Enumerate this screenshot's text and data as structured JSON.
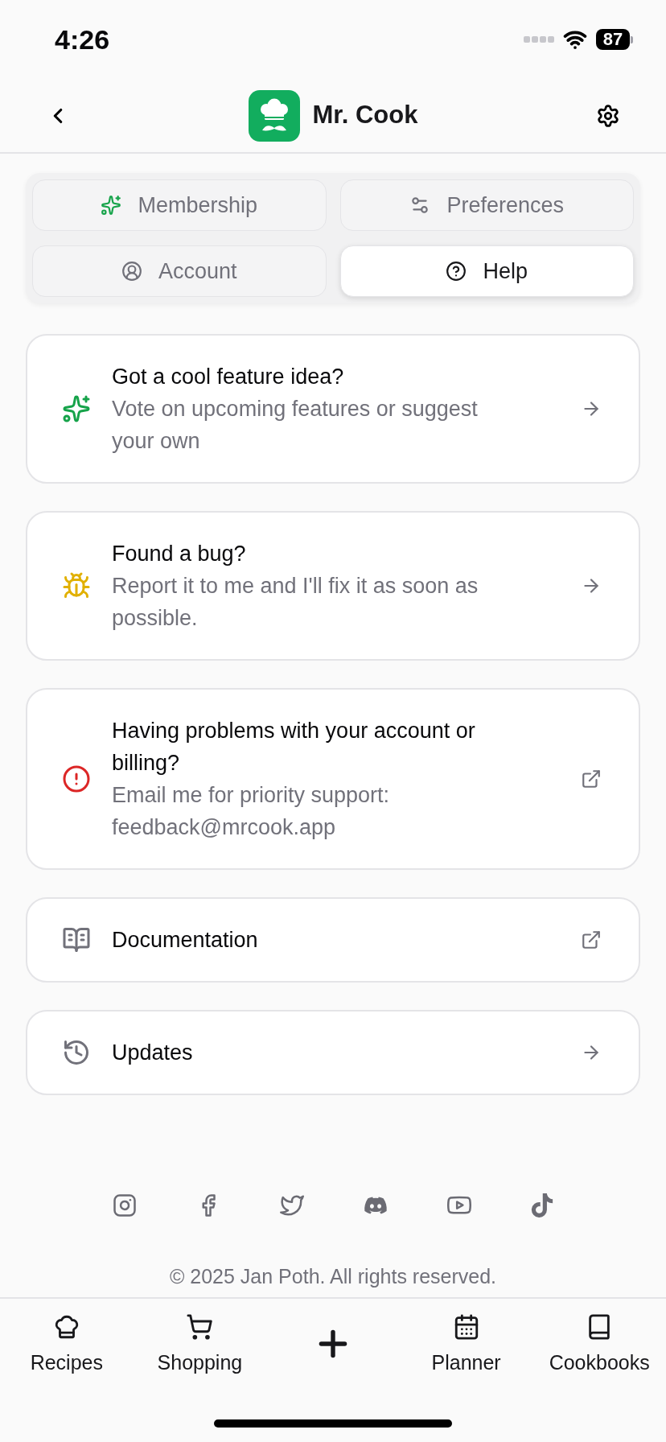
{
  "status_bar": {
    "time": "4:26",
    "battery": "87"
  },
  "header": {
    "title": "Mr. Cook"
  },
  "tabs": [
    {
      "label": "Membership",
      "selected": false
    },
    {
      "label": "Preferences",
      "selected": false
    },
    {
      "label": "Account",
      "selected": false
    },
    {
      "label": "Help",
      "selected": true
    }
  ],
  "cards": [
    {
      "title": "Got a cool feature idea?",
      "description": "Vote on upcoming features or suggest your own",
      "kind": "internal"
    },
    {
      "title": "Found a bug?",
      "description": "Report it to me and I'll fix it as soon as possible.",
      "kind": "internal"
    },
    {
      "title": "Having problems with your account or billing?",
      "description": "Email me for priority support: feedback@mrcook.app",
      "kind": "external"
    },
    {
      "title": "Documentation",
      "kind": "external"
    },
    {
      "title": "Updates",
      "kind": "internal"
    }
  ],
  "footer": {
    "copyright": "© 2025 Jan Poth. All rights reserved."
  },
  "nav": {
    "left": [
      {
        "label": "Recipes",
        "selected": false
      },
      {
        "label": "Shopping",
        "selected": false
      }
    ],
    "right": [
      {
        "label": "Planner",
        "selected": false
      },
      {
        "label": "Cookbooks",
        "selected": false
      }
    ]
  }
}
